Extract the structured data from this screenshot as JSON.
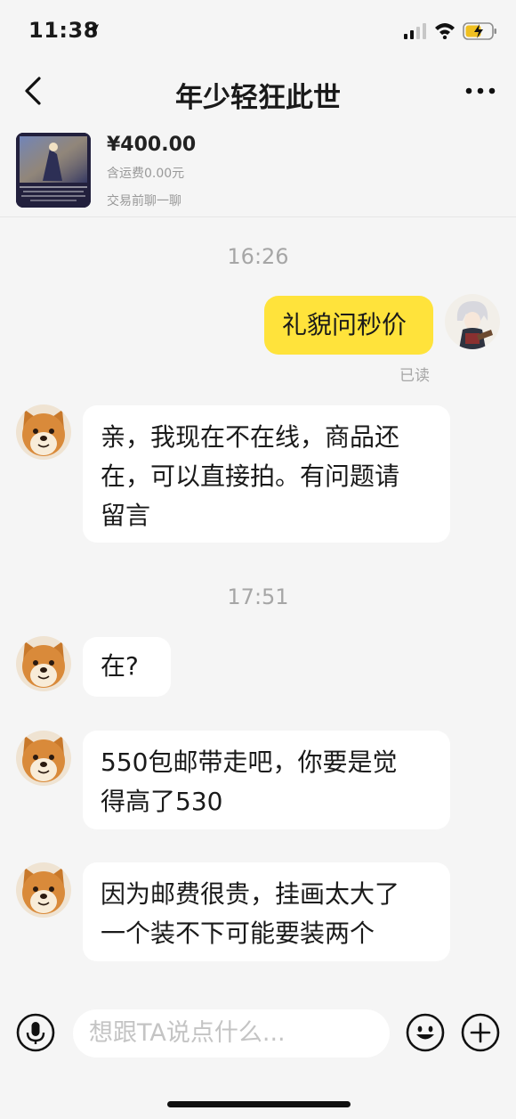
{
  "status_bar": {
    "time": "11:38",
    "icons": [
      "location-arrow-icon",
      "signal-icon",
      "wifi-icon",
      "battery-charging-icon"
    ]
  },
  "nav": {
    "title": "年少轻狂此世",
    "back_icon": "chevron-left-icon",
    "more_icon": "more-dots-icon"
  },
  "product": {
    "price": "¥400.00",
    "shipping": "含运费0.00元",
    "chat_hint": "交易前聊一聊"
  },
  "messages": [
    {
      "type": "timestamp",
      "text": "16:26"
    },
    {
      "type": "outgoing",
      "text": "礼貌问秒价",
      "status": "已读"
    },
    {
      "type": "incoming",
      "lines": [
        "亲，我现在不在线，商品还",
        "在，可以直接拍。有问题请",
        "留言"
      ]
    },
    {
      "type": "timestamp",
      "text": "17:51"
    },
    {
      "type": "incoming",
      "lines": [
        "在?"
      ]
    },
    {
      "type": "incoming",
      "lines": [
        "550包邮带走吧，你要是觉",
        "得高了530"
      ]
    },
    {
      "type": "incoming",
      "lines": [
        "因为邮费很贵，挂画太大了",
        "一个装不下可能要装两个"
      ]
    }
  ],
  "input_bar": {
    "placeholder": "想跟TA说点什么...",
    "icons": [
      "microphone-icon",
      "emoji-icon",
      "plus-icon"
    ]
  },
  "colors": {
    "background": "#f5f5f5",
    "outgoing_bubble": "#ffe33b",
    "incoming_bubble": "#ffffff"
  }
}
